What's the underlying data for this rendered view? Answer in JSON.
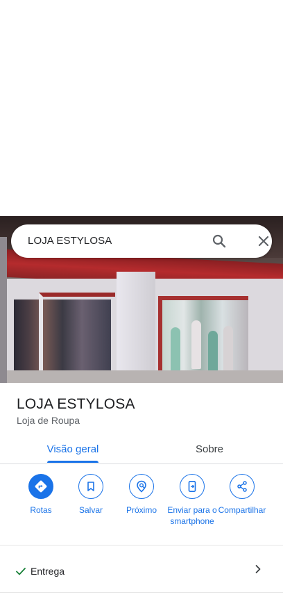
{
  "search": {
    "query": "LOJA ESTYLOSA"
  },
  "place": {
    "name": "LOJA ESTYLOSA",
    "category": "Loja de Roupa"
  },
  "tabs": [
    {
      "label": "Visão geral",
      "active": true
    },
    {
      "label": "Sobre",
      "active": false
    }
  ],
  "actions": [
    {
      "label": "Rotas",
      "icon": "directions-icon"
    },
    {
      "label": "Salvar",
      "icon": "bookmark-icon"
    },
    {
      "label": "Próximo",
      "icon": "nearby-icon"
    },
    {
      "label": "Enviar para o smartphone",
      "icon": "send-to-phone-icon"
    },
    {
      "label": "Compartilhar",
      "icon": "share-icon"
    }
  ],
  "attributes": [
    {
      "label": "Entrega",
      "icon": "check-icon"
    }
  ],
  "colors": {
    "accent": "#1a73e8",
    "text": "#202124",
    "secondary_text": "#5f6368",
    "check": "#188038"
  }
}
